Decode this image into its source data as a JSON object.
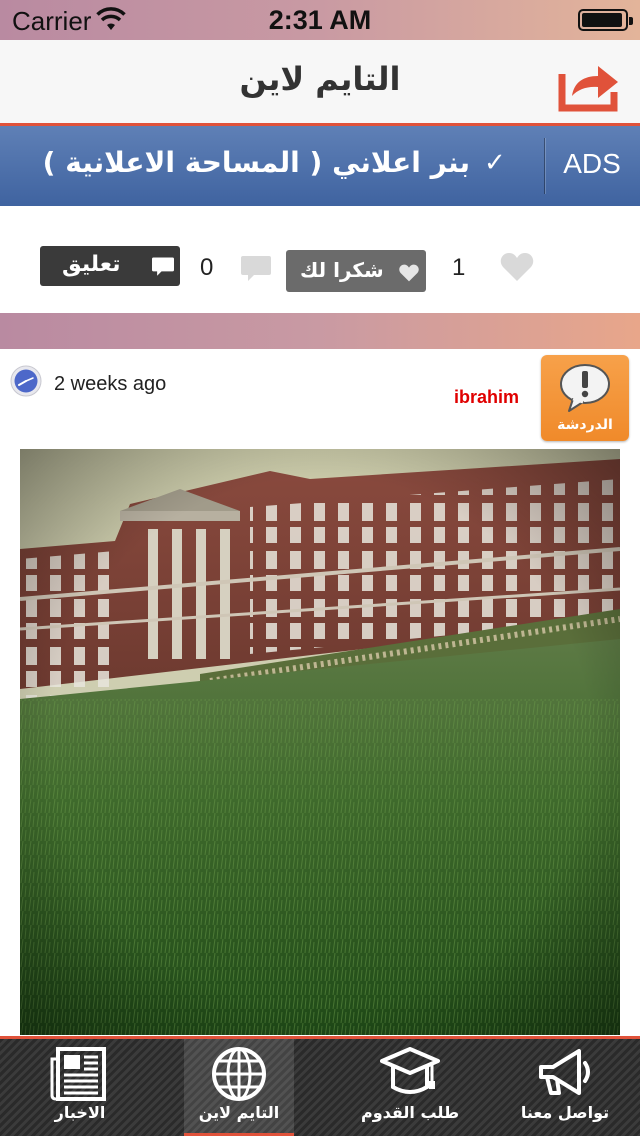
{
  "status_bar": {
    "carrier": "Carrier",
    "time": "2:31 AM",
    "battery_level": 0.9
  },
  "nav": {
    "title": "التايم لاين",
    "share_icon": "share-arrow-icon",
    "accent_color": "#e0523a"
  },
  "ads_banner": {
    "text": "بنر اعلاني ( المساحة الاعلانية )",
    "check": "✓",
    "ads_label": "ADS",
    "color": "#4a6ba7"
  },
  "actions": {
    "like_count": "1",
    "thanks_label": "شكرا لك",
    "comment_count": "0",
    "comment_label": "تعليق"
  },
  "post": {
    "time": "2 weeks ago",
    "author": "ibrahim",
    "chat_label": "الدردشة",
    "chat_color": "#f08a2a"
  },
  "tab_bar": {
    "tabs": [
      {
        "label": "تواصل معنا",
        "icon": "megaphone-icon"
      },
      {
        "label": "طلب القدوم",
        "icon": "graduation-cap-icon"
      },
      {
        "label": "التايم لاين",
        "icon": "globe-icon",
        "active": true
      },
      {
        "label": "الاخبار",
        "icon": "newspaper-icon"
      }
    ]
  }
}
